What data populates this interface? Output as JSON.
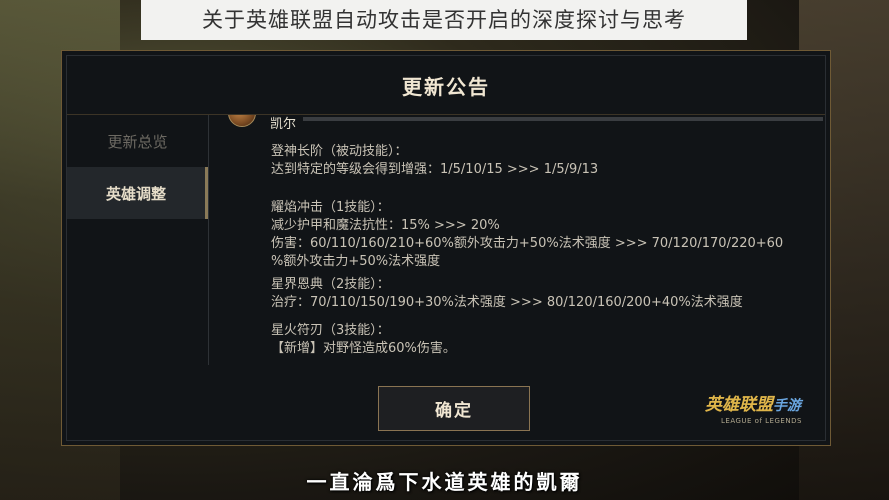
{
  "page": {
    "banner_title": "关于英雄联盟自动攻击是否开启的深度探讨与思考",
    "subtitle": "一直淪爲下水道英雄的凱爾"
  },
  "dialog": {
    "title": "更新公告",
    "sidebar": {
      "items": [
        {
          "label": "更新总览",
          "active": false
        },
        {
          "label": "英雄调整",
          "active": true
        }
      ]
    },
    "champion_name": "凯尔",
    "skills": [
      {
        "lines": [
          "登神长阶（被动技能）：",
          "达到特定的等级会得到增强：1/5/10/15  >>>  1/5/9/13"
        ]
      },
      {
        "lines": [
          "耀焰冲击（1技能）：",
          "减少护甲和魔法抗性：15%  >>>  20%",
          "伤害：60/110/160/210+60%额外攻击力+50%法术强度  >>>  70/120/170/220+60",
          "%额外攻击力+50%法术强度"
        ]
      },
      {
        "lines": [
          "星界恩典（2技能）：",
          "治疗：70/110/150/190+30%法术强度  >>>  80/120/160/200+40%法术强度"
        ]
      },
      {
        "lines": [
          "星火符刃（3技能）：",
          "【新增】对野怪造成60%伤害。"
        ]
      }
    ],
    "ok_button": "确定",
    "logo": {
      "cn": "英雄联盟",
      "cn_suffix": "手游",
      "en": "LEAGUE of LEGENDS"
    }
  },
  "colors": {
    "accent_gold": "#8a7452",
    "text_light": "#f0e6d2",
    "text_body": "#c9c3b6",
    "panel_bg": "#111417"
  }
}
